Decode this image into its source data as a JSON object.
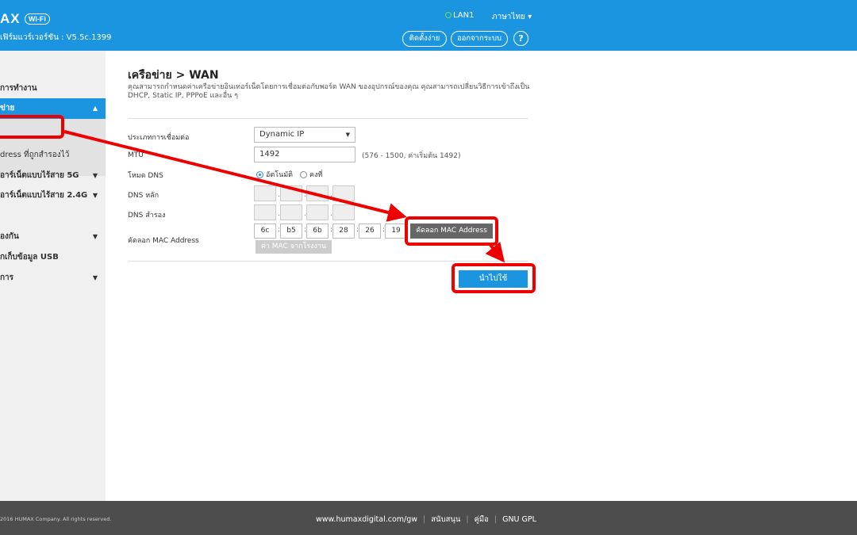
{
  "header": {
    "logo_text": "AX",
    "logo_badge": "Wi-Fi",
    "firmware": "เฟิร์มแวร์เวอร์ชัน : V5.5c.1399",
    "lan_status": "LAN1",
    "language": "ภาษาไทย",
    "setup_button": "ติดตั้งง่าย",
    "logout_button": "ออกจากระบบ",
    "help_button": "?"
  },
  "sidebar": {
    "items": [
      {
        "label": "การทำงาน"
      },
      {
        "label": "ข่าย"
      },
      {
        "label": ""
      },
      {
        "label": "dress ที่ถูกสำรองไว้"
      },
      {
        "label": "อาร์เน็ตแบบไร้สาย 5G"
      },
      {
        "label": "อาร์เน็ตแบบไร้สาย 2.4G"
      },
      {
        "label": "องกัน"
      },
      {
        "label": "กเก็บข้อมูล USB"
      },
      {
        "label": "การ"
      }
    ]
  },
  "main": {
    "title": "เครือข่าย > WAN",
    "description": "คุณสามารถกำหนดค่าเครือข่ายอินเทอร์เน็ตโดยการเชื่อมต่อกับพอร์ต WAN ของอุปกรณ์ของคุณ คุณสามารถเปลี่ยนวิธีการเข้าถึงเป็น DHCP, Static IP, PPPoE และอื่น ๆ",
    "connection_type_label": "ประเภทการเชื่อมต่อ",
    "connection_type_value": "Dynamic IP",
    "mtu_label": "MTU",
    "mtu_value": "1492",
    "mtu_hint": "(576 - 1500, ค่าเริ่มต้น 1492)",
    "dns_mode_label": "โหมด DNS",
    "dns_auto_label": "อัตโนมัติ",
    "dns_static_label": "คงที่",
    "dns_primary_label": "DNS หลัก",
    "dns_secondary_label": "DNS สำรอง",
    "mac_clone_label": "คัดลอก MAC Address",
    "mac_octets": [
      "6c",
      "b5",
      "6b",
      "28",
      "26",
      "19"
    ],
    "clone_mac_button": "คัดลอก MAC Address",
    "factory_mac_button": "ค่า MAC จากโรงงาน",
    "apply_button": "นำไปใช้"
  },
  "footer": {
    "copyright": "2016 HUMAX Company. All rights reserved.",
    "links": [
      "www.humaxdigital.com/gw",
      "สนับสนุน",
      "คู่มือ",
      "GNU GPL"
    ]
  },
  "colors": {
    "accent": "#1b95e0",
    "annotation": "#ee0000",
    "footer_bg": "#4d4d4d"
  }
}
